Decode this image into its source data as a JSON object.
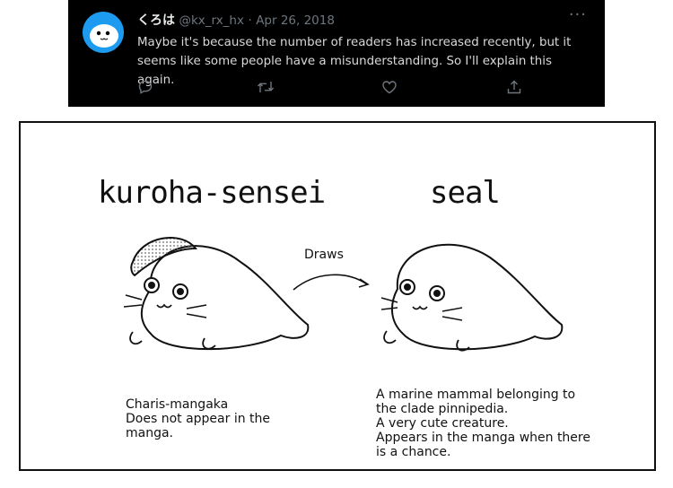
{
  "tweet": {
    "author_name": "くろは",
    "handle": "@kx_rx_hx",
    "separator": "·",
    "date": "Apr 26, 2018",
    "more_label": "···",
    "text": "Maybe it's because the number of readers has increased recently, but it seems like some people have a misunderstanding. So I'll explain this again.",
    "actions": [
      "reply-icon",
      "retweet-icon",
      "like-icon",
      "share-icon"
    ]
  },
  "comic": {
    "left_title": "kuroha-sensei",
    "right_title": "seal",
    "arrow_label": "Draws",
    "left_caption": [
      "Charis-mangaka",
      "Does not appear in the",
      "manga."
    ],
    "right_caption": [
      "A marine mammal belonging to",
      "the clade pinnipedia.",
      "A very cute creature.",
      "Appears in the manga when there",
      "is a chance."
    ]
  }
}
